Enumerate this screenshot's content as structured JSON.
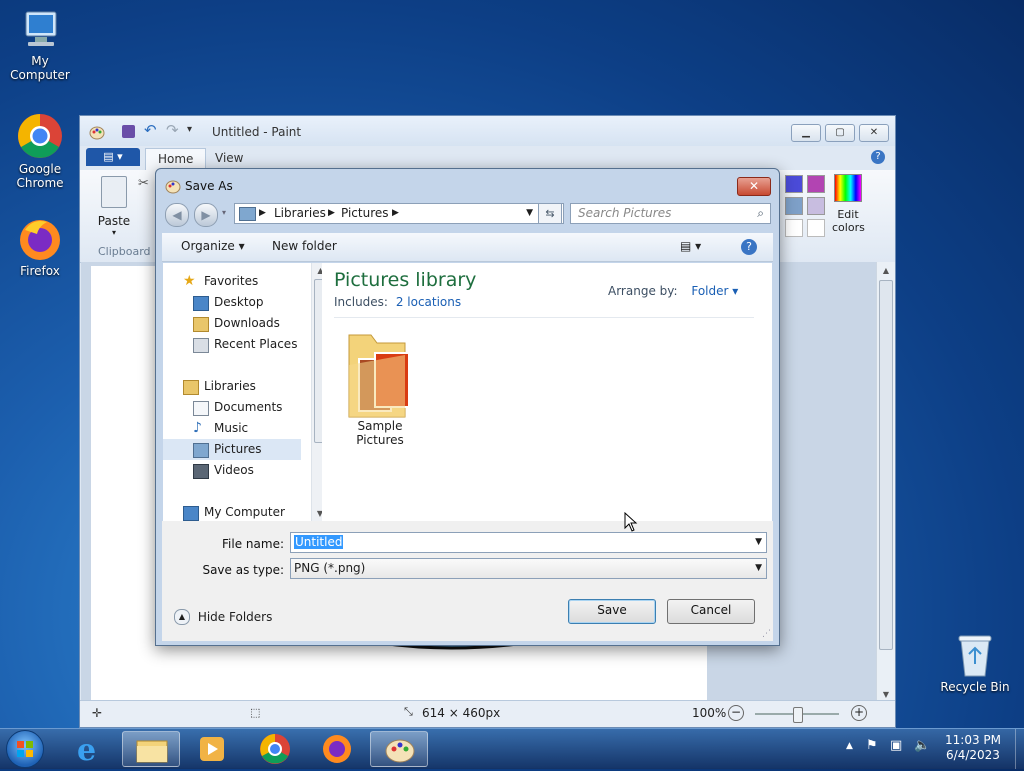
{
  "desktop": {
    "icons": [
      {
        "label": "My Computer"
      },
      {
        "label": "Google\nChrome"
      },
      {
        "label": "Firefox"
      },
      {
        "label": "Recycle Bin"
      }
    ]
  },
  "paint": {
    "title": "Untitled - Paint",
    "tabs": [
      "Home",
      "View"
    ],
    "ribbon": {
      "paste_label": "Paste",
      "clipboard_group": "Clipboard",
      "edit_colors_label": "Edit\ncolors",
      "colors": [
        "#4b4bd8",
        "#b244b2",
        "#7ea0c8",
        "#c8bde0",
        "#ffffff",
        "#ffffff"
      ]
    },
    "status": {
      "dimensions": "614 × 460px",
      "zoom": "100%"
    }
  },
  "dialog": {
    "title": "Save As",
    "address": [
      "Libraries",
      "Pictures"
    ],
    "search_placeholder": "Search Pictures",
    "toolbar": {
      "organize": "Organize",
      "new_folder": "New folder"
    },
    "nav": {
      "favorites": "Favorites",
      "favorites_items": [
        "Desktop",
        "Downloads",
        "Recent Places"
      ],
      "libraries": "Libraries",
      "libraries_items": [
        "Documents",
        "Music",
        "Pictures",
        "Videos"
      ],
      "computer": "My Computer"
    },
    "library": {
      "title": "Pictures library",
      "includes_label": "Includes:",
      "includes_link": "2 locations",
      "arrange_label": "Arrange by:",
      "arrange_value": "Folder"
    },
    "items": [
      {
        "name": "Sample Pictures"
      }
    ],
    "file_name_label": "File name:",
    "file_name_value": "Untitled",
    "save_type_label": "Save as type:",
    "save_type_value": "PNG (*.png)",
    "hide_folders": "Hide Folders",
    "save_button": "Save",
    "cancel_button": "Cancel"
  },
  "taskbar": {
    "time": "11:03 PM",
    "date": "6/4/2023"
  }
}
